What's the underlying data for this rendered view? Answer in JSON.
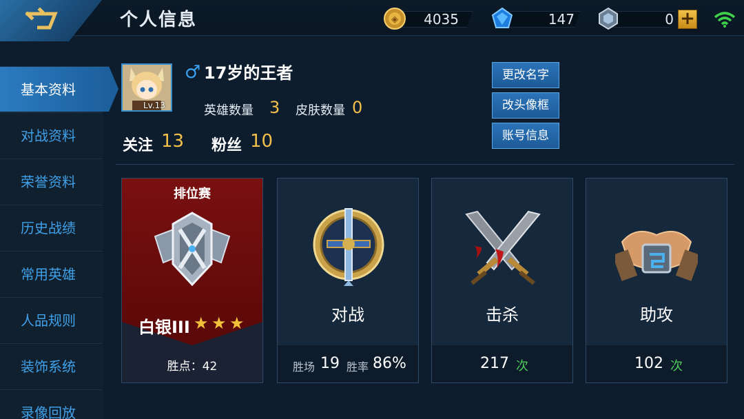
{
  "header": {
    "title": "个人信息",
    "gold": "4035",
    "diamond": "147",
    "coupon": "0",
    "plus_icon": "plus-icon",
    "wifi_icon": "wifi-icon"
  },
  "sidebar": {
    "items": [
      {
        "label": "基本资料",
        "active": true
      },
      {
        "label": "对战资料"
      },
      {
        "label": "荣誉资料"
      },
      {
        "label": "历史战绩"
      },
      {
        "label": "常用英雄"
      },
      {
        "label": "人品规则"
      },
      {
        "label": "装饰系统"
      },
      {
        "label": "录像回放"
      }
    ]
  },
  "profile": {
    "gender_symbol": "♂",
    "nickname": "17岁的王者",
    "level": "Lv.13",
    "heroes_label": "英雄数量",
    "heroes_count": "3",
    "skins_label": "皮肤数量",
    "skins_count": "0",
    "follow_label": "关注",
    "follow_count": "13",
    "fans_label": "粉丝",
    "fans_count": "10"
  },
  "actions": {
    "rename": "更改名字",
    "change_frame": "改头像框",
    "account_info": "账号信息"
  },
  "cards": {
    "rank": {
      "title": "排位赛",
      "tier": "白银III",
      "stars": 3,
      "star_glyph": "★",
      "points_text": "胜点：42"
    },
    "battle": {
      "title": "对战",
      "wins_label": "胜场",
      "wins": "19",
      "rate_label": "胜率",
      "rate": "86%"
    },
    "kills": {
      "title": "击杀",
      "count": "217",
      "unit": "次"
    },
    "assists": {
      "title": "助攻",
      "count": "102",
      "unit": "次"
    }
  },
  "colors": {
    "accent_gold": "#f3c04a",
    "accent_blue": "#3fa0e8",
    "unit_green": "#4fcc5a",
    "rank_red": "#7a1010"
  }
}
